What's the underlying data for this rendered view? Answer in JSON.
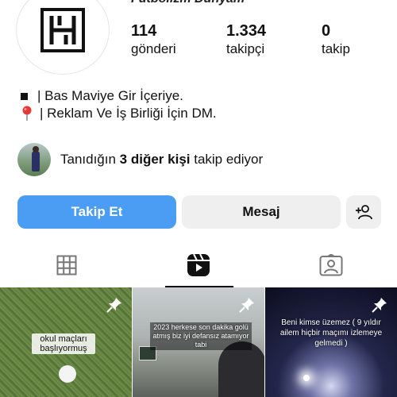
{
  "profile": {
    "name": "Futbolizm Dünyam",
    "avatar_icon": "logo-icon"
  },
  "stats": [
    {
      "value": "114",
      "label": "gönderi"
    },
    {
      "value": "1.334",
      "label": "takipçi"
    },
    {
      "value": "0",
      "label": "takip"
    }
  ],
  "bio": {
    "line1": "| Bas Maviye Gir İçeriye.",
    "line2": "| Reklam Ve İş Birliği İçin DM.",
    "line1_icon": "black-square-icon",
    "line2_icon": "pushpin-icon"
  },
  "mutual": {
    "prefix": "Tanıdığın ",
    "bold": "3 diğer kişi",
    "suffix": " takip ediyor"
  },
  "buttons": {
    "follow": "Takip Et",
    "message": "Mesaj",
    "add_user_icon": "add-user-icon"
  },
  "tabs": {
    "icons": [
      "grid-icon",
      "reels-icon",
      "tagged-icon"
    ],
    "active": "reels"
  },
  "posts": [
    {
      "caption": "okul maçları başlıyormuş",
      "pinned": true
    },
    {
      "caption": "2023 herkese son dakika golü atmış biz iyi defansız atamıyor tabi",
      "pinned": true
    },
    {
      "caption": "Beni kimse üzemez ( 9 yıldır ailem hiçbir maçımı izlemeye gelmedi )",
      "pinned": true
    }
  ],
  "colors": {
    "follow_button": "#4a9df3",
    "secondary_button": "#efefef",
    "text": "#111111"
  }
}
